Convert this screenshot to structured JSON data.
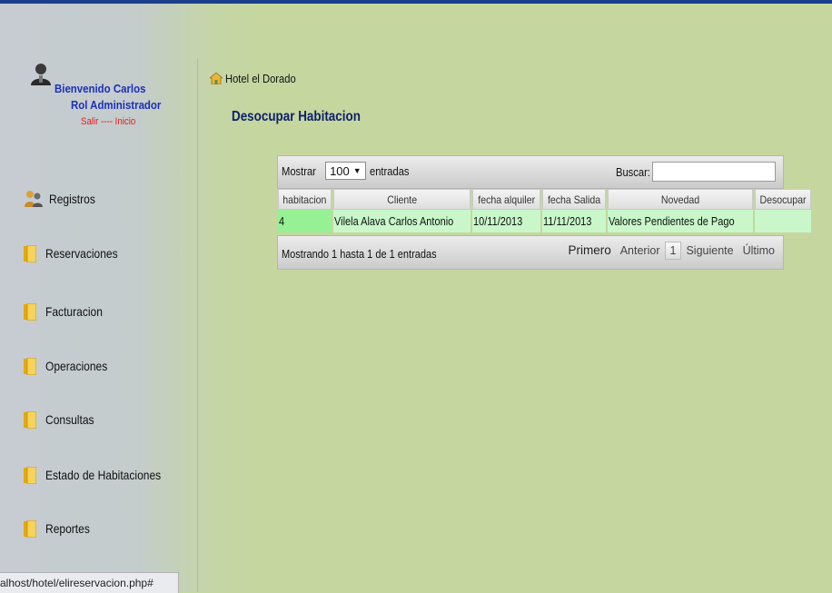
{
  "sidebar": {
    "user": {
      "welcome": "Bienvenido Carlos",
      "role": "Rol Administrador",
      "links": "Salir ---- Inicio"
    },
    "items": [
      {
        "label": "Registros",
        "icon": "users-icon"
      },
      {
        "label": "Reservaciones",
        "icon": "folder-icon"
      },
      {
        "label": "Facturacion",
        "icon": "folder-icon"
      },
      {
        "label": "Operaciones",
        "icon": "folder-icon"
      },
      {
        "label": "Consultas",
        "icon": "folder-icon"
      },
      {
        "label": "Estado de Habitaciones",
        "icon": "folder-icon"
      },
      {
        "label": "Reportes",
        "icon": "folder-icon"
      }
    ]
  },
  "status_bar": {
    "url": "alhost/hotel/elireservacion.php#"
  },
  "breadcrumb": {
    "home": "Hotel el Dorado",
    "icon": "home-icon"
  },
  "page": {
    "title": "Desocupar Habitacion"
  },
  "datatable": {
    "length": {
      "prefix": "Mostrar",
      "value": "100",
      "suffix": "entradas"
    },
    "search": {
      "label": "Buscar:",
      "value": ""
    },
    "columns": [
      "habitacion",
      "Cliente",
      "fecha alquiler",
      "fecha Salida",
      "Novedad",
      "Desocupar"
    ],
    "rows": [
      [
        "4",
        "Vilela Alava Carlos Antonio",
        "10/11/2013",
        "11/11/2013",
        "Valores Pendientes de Pago",
        ""
      ]
    ],
    "info": "Mostrando 1 hasta 1 de 1 entradas",
    "pagination": {
      "first": "Primero",
      "prev": "Anterior",
      "current": "1",
      "next": "Siguiente",
      "last": "Último"
    }
  },
  "colors": {
    "background": "#c5d79f",
    "title": "#0f1f6b",
    "user_text": "#1e2fb8",
    "logout": "#e41b1b",
    "row_highlight": "#c9f7ca"
  }
}
